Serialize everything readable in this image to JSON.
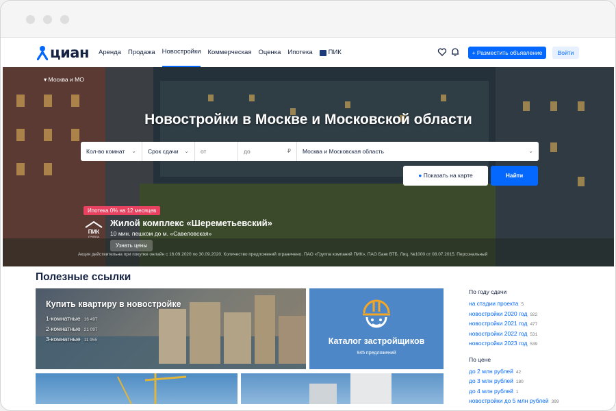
{
  "header": {
    "logo": "циан",
    "nav": [
      "Аренда",
      "Продажа",
      "Новостройки",
      "Коммерческая",
      "Оценка",
      "Ипотека",
      "ПИК"
    ],
    "post_button": "+ Разместить объявление",
    "login_button": "Войти"
  },
  "hero": {
    "region": "Москва и МО",
    "title": "Новостройки в Москве и Московской области",
    "search": {
      "rooms": "Кол-во комнат",
      "deadline": "Срок сдачи",
      "price_from": "от",
      "price_to": "до",
      "currency": "₽",
      "location": "Москва и Московская область"
    },
    "map_button": "Показать на карте",
    "find_button": "Найти",
    "promo": {
      "badge": "Ипотека 0% на 12 месяцев",
      "title": "Жилой комплекс «Шереметьевский»",
      "subtitle": "10 мин. пешком до м. «Савеловская»",
      "button": "Узнать цены",
      "logo_top": "ПИК",
      "logo_bottom": "ГРУППА",
      "disclaimer": "Акция действительна при покупке онлайн с 16.09.2020 по 30.09.2020. Количество предложений ограничено. ПАО «Группа компаний ПИК», ПАО Банк ВТБ. Лиц. №1000 от 08.07.2015. Персональный"
    }
  },
  "links": {
    "title": "Полезные ссылки",
    "buy_card": {
      "title": "Купить квартиру в новостройке",
      "rooms": [
        {
          "label": "1-комнатные",
          "count": "16 497"
        },
        {
          "label": "2-комнатные",
          "count": "21 097"
        },
        {
          "label": "3-комнатные",
          "count": "11 955"
        }
      ]
    },
    "catalog_card": {
      "title": "Каталог застройщиков",
      "subtitle": "945 предложений"
    }
  },
  "sidebar": {
    "by_year_title": "По году сдачи",
    "by_year": [
      {
        "label": "на стадии проекта",
        "count": "5"
      },
      {
        "label": "новостройки 2020 год",
        "count": "922"
      },
      {
        "label": "новостройки 2021 год",
        "count": "477"
      },
      {
        "label": "новостройки 2022 год",
        "count": "531"
      },
      {
        "label": "новостройки 2023 год",
        "count": "539"
      }
    ],
    "by_price_title": "По цене",
    "by_price": [
      {
        "label": "до 2 млн рублей",
        "count": "42"
      },
      {
        "label": "до 3 млн рублей",
        "count": "180"
      },
      {
        "label": "до 4 млн рублей",
        "count": "1"
      },
      {
        "label": "новостройки до 5 млн рублей",
        "count": "399"
      }
    ]
  },
  "colors": {
    "brand": "#0468ff",
    "promo": "#e84260",
    "catalog": "#4d87c7",
    "text": "#152242"
  }
}
